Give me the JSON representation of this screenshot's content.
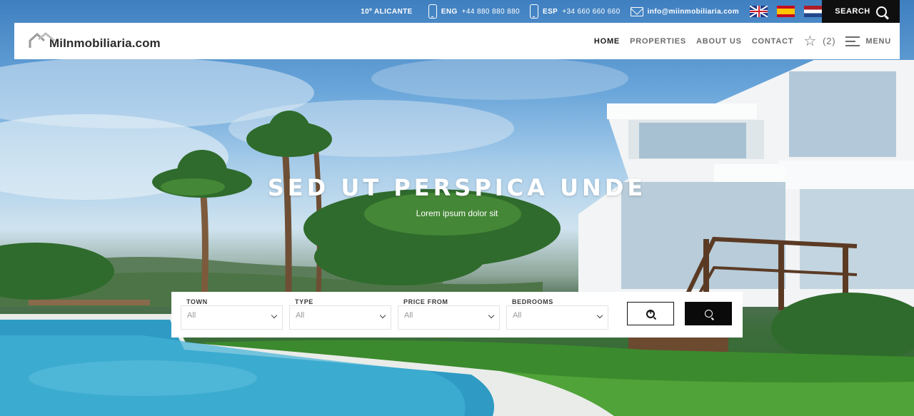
{
  "topbar": {
    "weather": "10º ALICANTE",
    "phones": [
      {
        "lang": "ENG",
        "number": "+44 880 880 880",
        "icon": "phone-icon"
      },
      {
        "lang": "ESP",
        "number": "+34 660 660 660",
        "icon": "phone-icon"
      }
    ],
    "email": "info@miinmobiliaria.com",
    "flags": [
      "english-flag-icon",
      "spanish-flag-icon",
      "dutch-flag-icon"
    ],
    "search_label": "SEARCH"
  },
  "navbar": {
    "logo_text": "MiInmobiliaria.com",
    "items": [
      {
        "label": "HOME",
        "active": true
      },
      {
        "label": "PROPERTIES",
        "active": false
      },
      {
        "label": "ABOUT US",
        "active": false
      },
      {
        "label": "CONTACT",
        "active": false
      }
    ],
    "favorites_count": "(2)",
    "menu_label": "MENU"
  },
  "hero": {
    "title": "SED UT PERSPICA UNDE",
    "subtitle": "Lorem ipsum dolor sit"
  },
  "search": {
    "fields": [
      {
        "label": "TOWN",
        "value": "All"
      },
      {
        "label": "TYPE",
        "value": "All"
      },
      {
        "label": "PRICE FROM",
        "value": "All"
      },
      {
        "label": "BEDROOMS",
        "value": "All"
      }
    ]
  },
  "colors": {
    "accent": "#0f0f0f",
    "nav_active": "#1c1c1c",
    "nav_inactive": "#6b6b6b"
  }
}
